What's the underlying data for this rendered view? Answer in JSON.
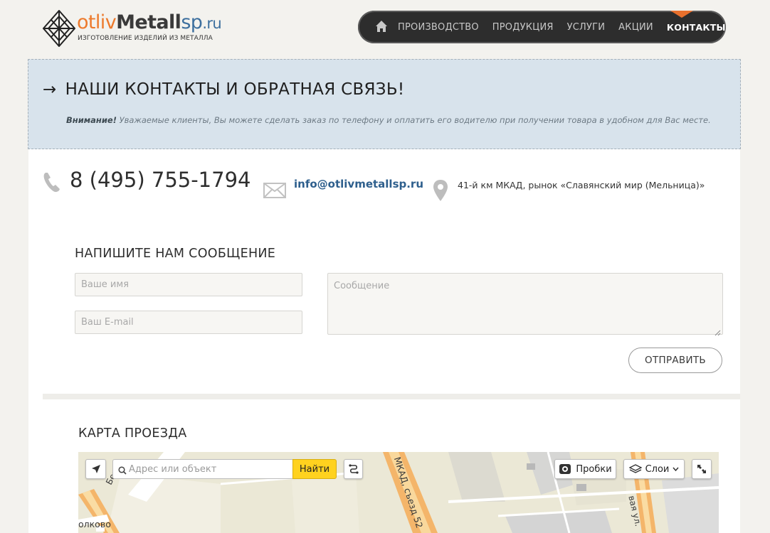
{
  "header": {
    "logo": {
      "part1": "otliv",
      "part2": "Metall",
      "part3": "sp",
      "part4": ".ru",
      "tagline": "ИЗГОТОВЛЕНИЕ ИЗДЕЛИЙ ИЗ МЕТАЛЛА"
    },
    "nav": {
      "home_icon": "home-icon",
      "items": [
        {
          "label": "ПРОИЗВОДСТВО",
          "active": false
        },
        {
          "label": "ПРОДУКЦИЯ",
          "active": false
        },
        {
          "label": "УСЛУГИ",
          "active": false
        },
        {
          "label": "АКЦИИ",
          "active": false
        },
        {
          "label": "КОНТАКТЫ",
          "active": true
        }
      ]
    }
  },
  "banner": {
    "arrow": "→",
    "title": "НАШИ КОНТАКТЫ И ОБРАТНАЯ СВЯЗЬ!",
    "note_bold": "Внимание!",
    "note_text": " Уважаемые клиенты, Вы можете сделать заказ по телефону и оплатить его водителю при получении товара в удобном для Вас месте."
  },
  "contacts": {
    "phone": "8 (495) 755-1794",
    "email": "info@otlivmetallsp.ru",
    "address": "41-й км МКАД, рынок «Славянский мир (Мельница)»"
  },
  "form": {
    "title": "НАПИШИТЕ НАМ СООБЩЕНИЕ",
    "name_placeholder": "Ваше имя",
    "email_placeholder": "Ваш E-mail",
    "message_placeholder": "Сообщение",
    "submit_label": "ОТПРАВИТЬ"
  },
  "map": {
    "title": "КАРТА ПРОЕЗДА",
    "search_placeholder": "Адрес или объект",
    "find_label": "Найти",
    "traffic_label": "Пробки",
    "layers_label": "Слои",
    "labels": {
      "road": "МКАД, съезд 52",
      "street_left": "Бере",
      "area": "олково",
      "street_right": "вая ул."
    }
  },
  "colors": {
    "accent_orange": "#e8702d",
    "nav_bg": "#2d2d2d",
    "banner_bg": "#d8e3ec",
    "link_blue": "#2e5f8d",
    "find_button": "#ffd21f"
  }
}
